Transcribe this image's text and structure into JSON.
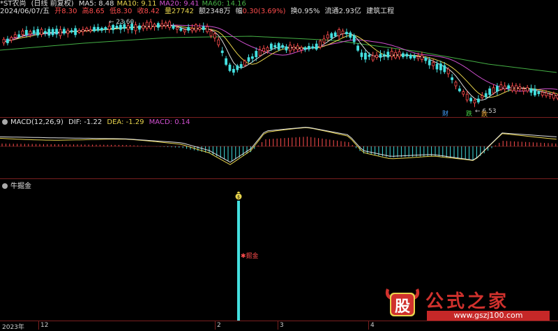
{
  "header": {
    "stock_name": "*ST农尚",
    "mode": "(日线 前复权)",
    "ma": [
      {
        "label": "MA5: 8.48",
        "color": "#e0e0e0"
      },
      {
        "label": "MA10: 9.11",
        "color": "#e8d44d"
      },
      {
        "label": "MA20: 9.41",
        "color": "#d050d0"
      },
      {
        "label": "MA60: 14.16",
        "color": "#45b045"
      }
    ],
    "date": "2024/06/07/五",
    "open": "开8.30",
    "high": "高8.65",
    "low": "低8.30",
    "close": "收8.42",
    "volume": "量27742",
    "amount": "额2348万",
    "change_label": "幅",
    "change_value": "0.30(3.69%)",
    "turnover": "换0.95%",
    "float": "流通2.93亿",
    "industry": "建筑工程"
  },
  "price_panel": {
    "high_marker": "23.60",
    "low_marker": "6.53",
    "event_tags": [
      "财",
      "跌",
      "跌"
    ]
  },
  "macd_panel": {
    "title": "MACD(12,26,9)",
    "dif": "DIF: -1.22",
    "dea": "DEA: -1.29",
    "macd": "MACD: 0.14",
    "dif_color": "#e0e0e0",
    "dea_color": "#e8d44d",
    "macd_color": "#d050d0"
  },
  "signal_panel": {
    "title": "牛掘金",
    "signal_label": "掘金",
    "signal_icon": "money-bag-icon"
  },
  "xaxis": {
    "ticks": [
      "2023年",
      "12",
      "2",
      "3",
      "4"
    ]
  },
  "logo": {
    "badge_text": "股",
    "brand": "公式之家",
    "url": "www.gszj100.com"
  },
  "colors": {
    "up": "#ff4d4d",
    "down": "#44e0e0",
    "separator": "#7a1f1f",
    "signal": "#44e0e0"
  }
}
